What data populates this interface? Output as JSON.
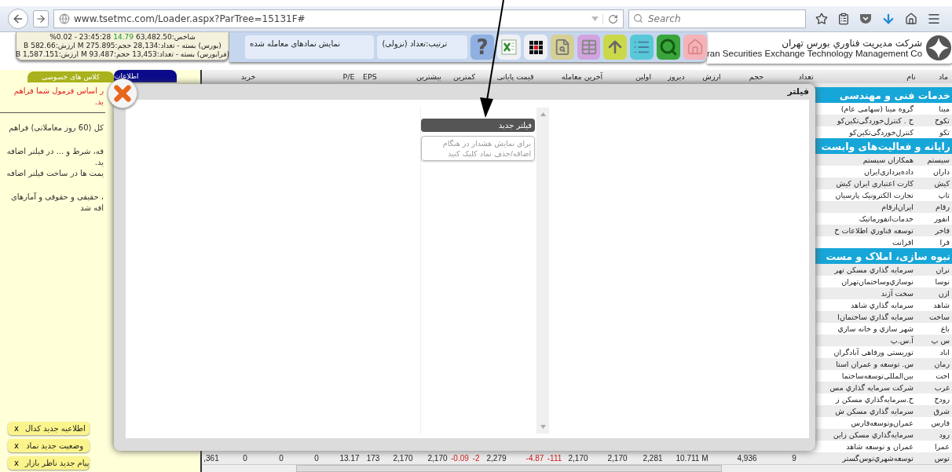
{
  "browser": {
    "url": "www.tsetmc.com/Loader.aspx?ParTree=15131F#",
    "search": {
      "placeholder": "Search"
    }
  },
  "market_summary": {
    "index_label": "شاخص:63,482.50",
    "index_change": "14.79",
    "index_rest": "%0.02 - 23:45:28",
    "lines": [
      "(بورس) بسته - تعداد:28,134 حجم:275.895 M ارزش:582.66 B",
      "(فرابورس) بسته - تعداد:13,453 حجم:93.487 M ارزش:1,587.151 B"
    ]
  },
  "toolbar": {
    "sort": "ترتیب:تعداد (نزولی)",
    "traded_toggle": "نمایش نمادهای معامله شده",
    "buttons": [
      {
        "kind": "help",
        "label": "?"
      },
      {
        "kind": "excel"
      },
      {
        "kind": "grid"
      },
      {
        "kind": "preview"
      },
      {
        "kind": "table"
      },
      {
        "kind": "up"
      },
      {
        "kind": "list"
      },
      {
        "kind": "search"
      },
      {
        "kind": "home"
      }
    ]
  },
  "company": {
    "name_fa": "شرکت مدیریت فناوري بورس تهران",
    "name_en": "ran Securities Exchange Technology Management Co"
  },
  "side_panel": {
    "tabs": [
      {
        "label": "اطلاعات",
        "selected": true
      },
      {
        "label": "کلاس های خصوصی",
        "selected": false
      }
    ],
    "notes": [
      {
        "kind": "alert",
        "lines": [
          "ر اساس فرمول شما فراهم",
          "ید."
        ]
      },
      {
        "kind": "plain",
        "lines": [
          "کل (60 روز معاملاتی) فراهم"
        ]
      },
      {
        "kind": "plain",
        "lines": [
          "قه، شرط و ... در فیلتر اضافه",
          "ید.",
          "یمت ها در ساخت فیلتر اضافه"
        ]
      },
      {
        "kind": "plain",
        "lines": [
          "، حقیقی و حقوقی و آمارهای",
          "افه شد"
        ]
      }
    ],
    "notifications": [
      {
        "close": "x",
        "label": "اطلاعیه جدید کدال"
      },
      {
        "close": "x",
        "label": "وضعیت جدید نماد"
      },
      {
        "close": "x",
        "label": "پیام جدید ناظر بازار"
      }
    ]
  },
  "table": {
    "columns": [
      "ماد",
      "نام",
      "تعداد",
      "حجم",
      "ارزش",
      "دیروز",
      "اولین",
      "آخرین معامله",
      "قیمت پایانی",
      "کمترین",
      "بیشترین",
      "EPS",
      "P/E",
      "خرید"
    ],
    "rows": [
      {
        "kind": "section",
        "title": "خدمات فنی و مهندسی"
      },
      {
        "kind": "stock",
        "symbol": "مینا",
        "name": "گروه مینا (سهامی عام)"
      },
      {
        "kind": "stock",
        "symbol": "تکوح",
        "name": "ح . کنترل‌خوردگی‌تکین‌کو"
      },
      {
        "kind": "stock",
        "symbol": "تکو",
        "name": "کنترل‌خوردگی‌تکین‌کو"
      },
      {
        "kind": "section",
        "title": "رایانه و فعالیت‌های وابست"
      },
      {
        "kind": "stock",
        "symbol": "سیستم",
        "name": "همکاران سیستم"
      },
      {
        "kind": "stock",
        "symbol": "داران",
        "name": "داده‌پردازی‌ایران"
      },
      {
        "kind": "stock",
        "symbol": "کیش",
        "name": "کارت اعتباری ایران کیش"
      },
      {
        "kind": "stock",
        "symbol": "تاپ",
        "name": "تجارت الکترونیک پارسیان"
      },
      {
        "kind": "stock",
        "symbol": "رقام",
        "name": "ایران‌ارقام"
      },
      {
        "kind": "stock",
        "symbol": "انفور",
        "name": "خدمات‌انفورماتیک"
      },
      {
        "kind": "stock",
        "symbol": "فاخر",
        "name": "توسعه فناوري اطلاعات خ"
      },
      {
        "kind": "stock",
        "symbol": "فرا",
        "name": "افرانت"
      },
      {
        "kind": "section",
        "title": "نبوه سازی، املاک و مست"
      },
      {
        "kind": "stock",
        "symbol": "نران",
        "name": "سرمایه گذاري مسکن تهر"
      },
      {
        "kind": "stock",
        "symbol": "نوسا",
        "name": "نوسازي‌وساختمان‌تهران"
      },
      {
        "kind": "stock",
        "symbol": "ازن",
        "name": "سخت آژند"
      },
      {
        "kind": "stock",
        "symbol": "شاهد",
        "name": "سرمایه گذاري شاهد"
      },
      {
        "kind": "stock",
        "symbol": "ساخت",
        "name": "سرمایه گذاري ساختمان‌ا"
      },
      {
        "kind": "stock",
        "symbol": "باغ",
        "name": "شهر سازي و خانه سازي"
      },
      {
        "kind": "stock",
        "symbol": "س پ",
        "name": "آ.س.پ"
      },
      {
        "kind": "stock",
        "symbol": "اباد",
        "name": "توریستی ورفاهی آبادگران"
      },
      {
        "kind": "stock",
        "symbol": "رمان",
        "name": "س. توسعه و عمران استا"
      },
      {
        "kind": "stock",
        "symbol": "اخت",
        "name": "بین‌المللی‌توسعه‌ساختما"
      },
      {
        "kind": "stock",
        "symbol": "غرب",
        "name": "شرکت سرمایه گذاري مس"
      },
      {
        "kind": "stock",
        "symbol": "رودح",
        "name": "ح.سرمایه‌گذاري مسکن ز"
      },
      {
        "kind": "stock",
        "symbol": "شرق",
        "name": "سرمایه گذاري مسکن ش"
      },
      {
        "kind": "stock",
        "symbol": "فارس",
        "name": "عمران‌وتوسعه‌فارس"
      },
      {
        "kind": "stock",
        "symbol": "رود",
        "name": "سرمایه‌گذاري مسکن زاین"
      },
      {
        "kind": "stock",
        "symbol": "عمرا",
        "name": "عمران و توسعه شاهد"
      },
      {
        "kind": "stock",
        "symbol": "توس",
        "name": "توسعه‌شهري‌توس‌گستر",
        "values": [
          {
            "text": "9",
            "negative": false
          },
          {
            "text": "4,936",
            "negative": false
          },
          {
            "text": "10.711 M",
            "negative": false
          },
          {
            "text": "2,281",
            "negative": false
          },
          {
            "text": "2,170",
            "negative": false
          },
          {
            "text": "2,170",
            "negative": false
          },
          {
            "text": "-111",
            "negative": true
          },
          {
            "text": "-4.87",
            "negative": true
          },
          {
            "text": "2,279",
            "negative": false
          },
          {
            "text": "-2",
            "negative": true
          },
          {
            "text": "-0.09",
            "negative": true
          },
          {
            "text": "2,170",
            "negative": false
          },
          {
            "text": "2,170",
            "negative": false
          },
          {
            "text": "173",
            "negative": false
          },
          {
            "text": "13.17",
            "negative": false
          },
          {
            "text": "0",
            "negative": false
          },
          {
            "text": "0",
            "negative": false
          },
          {
            "text": "0",
            "negative": false
          },
          {
            "text": ",361",
            "negative": false
          }
        ]
      }
    ]
  },
  "modal": {
    "title": "فیلتر",
    "new_filter": "فیلتر جدید",
    "hint": "برای نمایش هشدار در هنگام اضافه/حذف نماد کلیک کنید"
  }
}
